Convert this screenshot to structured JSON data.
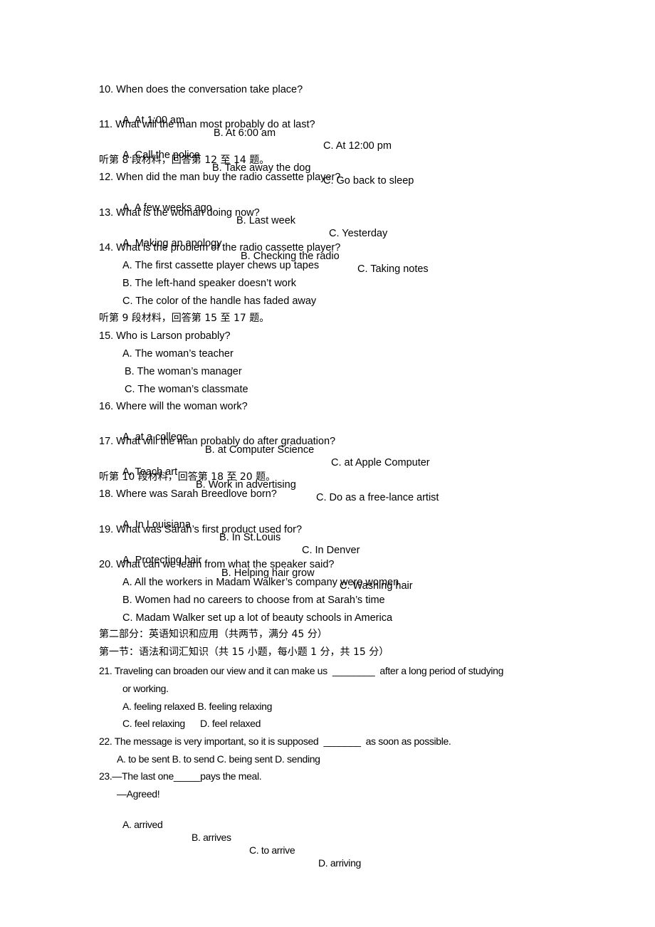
{
  "document": {
    "items": [
      {
        "type": "question",
        "text": "10. When does the conversation take place?",
        "options": [
          "A. At 1:00 am",
          "B. At 6:00 am",
          "C. At 12:00 pm"
        ]
      },
      {
        "type": "question",
        "text": "11. What will the man most probably do at last?",
        "options": [
          "A. Call the police",
          "B. Take away the dog",
          "C. Go back to sleep"
        ]
      },
      {
        "type": "section",
        "text": "听第 8 段材料，回答第 12 至 14 题。"
      },
      {
        "type": "question",
        "text": "12. When did the man buy the radio cassette player?",
        "options": [
          "A. A few weeks ago",
          "B. Last week",
          "C. Yesterday"
        ]
      },
      {
        "type": "question",
        "text": "13. What is the woman doing now?",
        "options": [
          "A. Making an apology",
          "B. Checking the radio",
          "C. Taking notes"
        ]
      },
      {
        "type": "question",
        "text": "14. What is the problem of the radio cassette player?",
        "options": [
          "A. The first cassette player chews up tapes",
          "B. The left-hand speaker doesn’t work",
          "C. The color of the handle has faded away"
        ]
      },
      {
        "type": "section",
        "text": "听第 9 段材料，回答第 15 至 17 题。"
      },
      {
        "type": "question",
        "text": "15. Who is Larson probably?",
        "options": [
          "A. The woman’s teacher",
          "B. The woman’s manager",
          "C. The woman’s classmate"
        ]
      },
      {
        "type": "question",
        "text": "16. Where will the woman work?",
        "options": [
          "A. at a college",
          "B. at Computer Science",
          "C. at Apple Computer"
        ]
      },
      {
        "type": "question",
        "text": "17. What will the man probably do after graduation?",
        "options": [
          "A. Teach art",
          "B. Work in advertising",
          "C. Do as a free-lance artist"
        ]
      },
      {
        "type": "section",
        "text": "听第 10 段材料，回答第 18 至 20 题。"
      },
      {
        "type": "question",
        "text": "18. Where was Sarah Breedlove born?",
        "options": [
          "A. In Louisiana",
          "B. In St.Louis",
          "C. In Denver"
        ]
      },
      {
        "type": "question",
        "text": "19. What was Sarah’s first product used for?",
        "options": [
          "A. Protecting hair",
          "B. Helping hair grow",
          "C. Washing hair"
        ]
      },
      {
        "type": "question",
        "text": "20. What can we learn from what the speaker said?",
        "options": [
          "A. All the workers in Madam Walker’s company were women",
          "B. Women had no careers to choose from at Sarah’s time",
          "C. Madam Walker set up a lot of beauty schools in America"
        ]
      },
      {
        "type": "part-heading",
        "text": "第二部分：英语知识和应用（共两节，满分 45 分）"
      },
      {
        "type": "part-heading",
        "text": "第一节：语法和词汇知识（共 15 小题，每小题 1 分，共 15 分）"
      },
      {
        "type": "question",
        "text": "21. Traveling can broaden our view and it can make us  ________  after a long period of studying",
        "continuation": "or working.",
        "option_lines": [
          "A. feeling relaxed B. feeling relaxing",
          "C. feel relaxing      D. feel relaxed"
        ]
      },
      {
        "type": "question",
        "text": "22. The message is very important, so it is supposed  _______  as soon as possible.",
        "option_lines": [
          "A. to be sent B. to send C. being sent D. sending"
        ]
      },
      {
        "type": "question",
        "text": "23.—The last one_____pays the meal.",
        "continuation": "—Agreed!",
        "options": [
          "A. arrived",
          "B. arrives",
          "C. to arrive",
          "D. arriving"
        ]
      }
    ]
  }
}
